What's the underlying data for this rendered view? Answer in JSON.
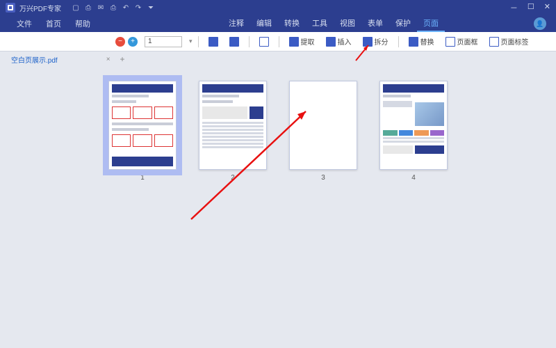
{
  "titlebar": {
    "app_name": "万兴PDF专家"
  },
  "menubar": {
    "items": [
      "文件",
      "首页",
      "帮助"
    ],
    "tabs": [
      "注释",
      "编辑",
      "转换",
      "工具",
      "视图",
      "表单",
      "保护",
      "页面"
    ],
    "active_tab_index": 7
  },
  "toolbar": {
    "page_value": "1",
    "buttons": {
      "extract": "提取",
      "insert": "插入",
      "split": "拆分",
      "replace": "替换",
      "pagebox": "页面框",
      "pagelabel": "页面标签"
    }
  },
  "doctab": {
    "filename": "空白页展示.pdf"
  },
  "thumbnails": {
    "count": 4,
    "selected": 1,
    "labels": [
      "1",
      "2",
      "3",
      "4"
    ]
  }
}
